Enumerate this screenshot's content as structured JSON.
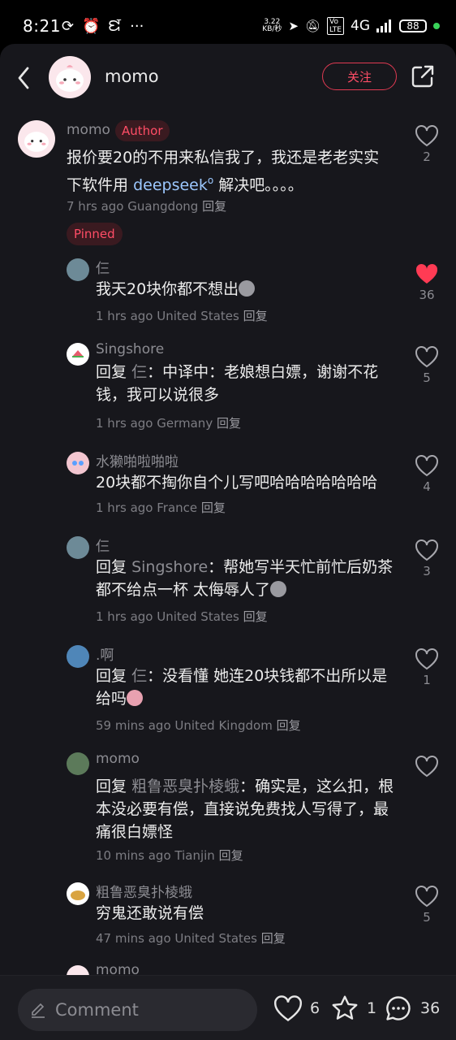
{
  "status_bar": {
    "time": "8:21",
    "speed_value": "3.22",
    "speed_unit": "KB/秒",
    "network": "4G",
    "battery": "88"
  },
  "header": {
    "username": "momo",
    "follow_label": "关注"
  },
  "main_comment": {
    "username": "momo",
    "author_badge": "Author",
    "text_before_link": "报价要20的不用来私信我了，我还是老老实实下软件用",
    "link_text": "deepseek",
    "text_after_link": "解决吧。。。。",
    "time": "7 hrs ago",
    "location": "Guangdong",
    "reply_label": "回复",
    "like_count": "2",
    "pinned_badge": "Pinned"
  },
  "replies": [
    {
      "username": "仨",
      "reply_to": "",
      "text": "我天20块你都不想出",
      "time": "1 hrs ago",
      "location": "United States",
      "reply_label": "回复",
      "likes": "36",
      "liked": true
    },
    {
      "username": "Singshore",
      "reply_prefix": "回复",
      "reply_to": "仨",
      "text": "：中译中：老娘想白嫖，谢谢不花钱，我可以说很多",
      "time": "1 hrs ago",
      "location": "Germany",
      "reply_label": "回复",
      "likes": "5"
    },
    {
      "username": "水獭啪啦啪啦",
      "reply_to": "",
      "text": "20块都不掏你自个儿写吧哈哈哈哈哈哈哈",
      "time": "1 hrs ago",
      "location": "France",
      "reply_label": "回复",
      "likes": "4"
    },
    {
      "username": "仨",
      "reply_prefix": "回复",
      "reply_to": "Singshore",
      "text": "：帮她写半天忙前忙后奶茶都不给点一杯 太侮辱人了",
      "time": "1 hrs ago",
      "location": "United States",
      "reply_label": "回复",
      "likes": "3"
    },
    {
      "username": ".啊",
      "reply_prefix": "回复",
      "reply_to": "仨",
      "text": "：没看懂 她连20块钱都不出所以是给吗",
      "time": "59 mins ago",
      "location": "United Kingdom",
      "reply_label": "回复",
      "likes": "1"
    },
    {
      "username": "momo",
      "reply_prefix": "回复",
      "reply_to": "粗鲁恶臭扑棱蛾",
      "text": "：确实是，这么扣，根本没必要有偿，直接说免费找人写得了，最痛很白嫖怪",
      "time": "10 mins ago",
      "location": "Tianjin",
      "reply_label": "回复",
      "likes": ""
    },
    {
      "username": "粗鲁恶臭扑棱蛾",
      "reply_to": "",
      "text": "穷鬼还敢说有偿",
      "time": "47 mins ago",
      "location": "United States",
      "reply_label": "回复",
      "likes": "5"
    },
    {
      "username": "momo"
    }
  ],
  "bottom_bar": {
    "comment_placeholder": "Comment",
    "likes": "6",
    "favorites": "1",
    "comments": "36"
  },
  "colors": {
    "accent": "#ff4d66",
    "background": "#17171c",
    "link": "#9cc8ff"
  }
}
